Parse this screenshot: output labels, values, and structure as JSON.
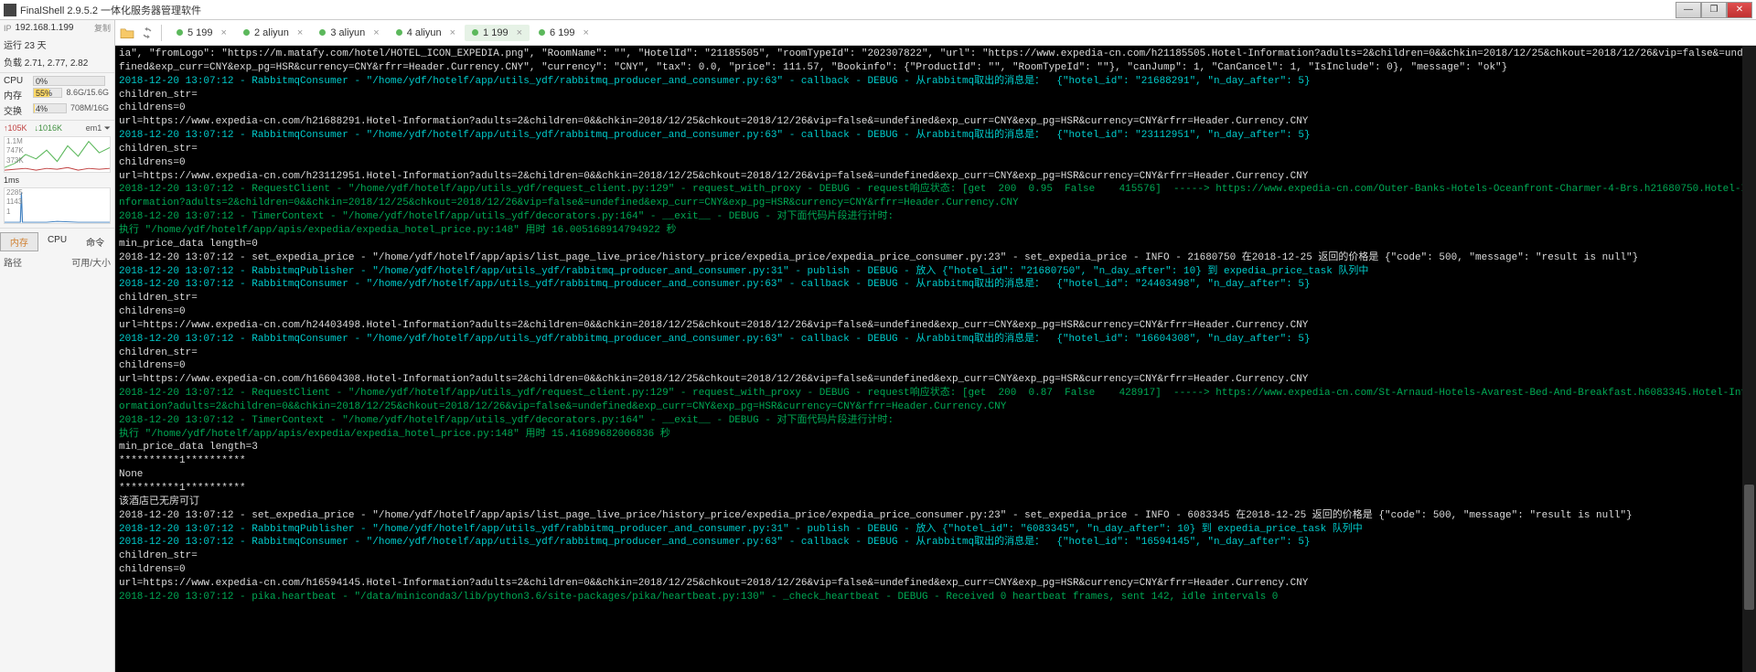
{
  "window": {
    "title": "FinalShell 2.9.5.2 一体化服务器管理软件"
  },
  "sidebar": {
    "ip_label": "IP",
    "ip_value": "192.168.1.199",
    "copy_label": "复制",
    "uptime": "运行 23 天",
    "load": "负载 2.71, 2.77, 2.82",
    "stats": [
      {
        "label": "CPU",
        "pct": "0%",
        "right": "",
        "fill": 0
      },
      {
        "label": "内存",
        "pct": "55%",
        "right": "8.6G/15.6G",
        "fill": 55
      },
      {
        "label": "交换",
        "pct": "4%",
        "right": "708M/16G",
        "fill": 4
      }
    ],
    "net": {
      "up": "↑105K",
      "down": "↓1016K",
      "iface": "em1",
      "suffix": "⏷"
    },
    "graph1_labels": [
      "1.1M",
      "747K",
      "373K"
    ],
    "graph2_labels": [
      "1ms",
      "2285",
      "1143",
      "1"
    ],
    "mtabs": [
      {
        "label": "内存",
        "active": true
      },
      {
        "label": "CPU",
        "active": false
      },
      {
        "label": "命令",
        "active": false
      }
    ],
    "cols": {
      "left": "路径",
      "right": "可用/大小"
    }
  },
  "tabs": [
    {
      "label": "5 199",
      "dot": "green",
      "active": false
    },
    {
      "label": "2 aliyun",
      "dot": "green",
      "active": false
    },
    {
      "label": "3 aliyun",
      "dot": "green",
      "active": false
    },
    {
      "label": "4 aliyun",
      "dot": "green",
      "active": false
    },
    {
      "label": "1 199",
      "dot": "green",
      "active": true
    },
    {
      "label": "6 199",
      "dot": "green",
      "active": false
    }
  ],
  "terminal_lines": [
    {
      "c": "white",
      "t": "ia\", \"fromLogo\": \"https://m.matafy.com/hotel/HOTEL_ICON_EXPEDIA.png\", \"RoomName\": \"\", \"HotelId\": \"21185505\", \"roomTypeId\": \"202307822\", \"url\": \"https://www.expedia-cn.com/h21185505.Hotel-Information?adults=2&children=0&&chkin=2018/12/25&chkout=2018/12/26&vip=false&=undefined&exp_curr=CNY&exp_pg=HSR&currency=CNY&rfrr=Header.Currency.CNY\", \"currency\": \"CNY\", \"tax\": 0.0, \"price\": 111.57, \"Bookinfo\": {\"ProductId\": \"\", \"RoomTypeId\": \"\"}, \"canJump\": 1, \"CanCancel\": 1, \"IsInclude\": 0}, \"message\": \"ok\"}"
    },
    {
      "c": "cyan",
      "t": "2018-12-20 13:07:12 - RabbitmqConsumer - \"/home/ydf/hotelf/app/utils_ydf/rabbitmq_producer_and_consumer.py:63\" - callback - DEBUG - 从rabbitmq取出的消息是：  {\"hotel_id\": \"21688291\", \"n_day_after\": 5}"
    },
    {
      "c": "white",
      "t": "children_str="
    },
    {
      "c": "white",
      "t": "childrens=0"
    },
    {
      "c": "white",
      "t": "url=https://www.expedia-cn.com/h21688291.Hotel-Information?adults=2&children=0&&chkin=2018/12/25&chkout=2018/12/26&vip=false&=undefined&exp_curr=CNY&exp_pg=HSR&currency=CNY&rfrr=Header.Currency.CNY"
    },
    {
      "c": "cyan",
      "t": "2018-12-20 13:07:12 - RabbitmqConsumer - \"/home/ydf/hotelf/app/utils_ydf/rabbitmq_producer_and_consumer.py:63\" - callback - DEBUG - 从rabbitmq取出的消息是：  {\"hotel_id\": \"23112951\", \"n_day_after\": 5}"
    },
    {
      "c": "white",
      "t": "children_str="
    },
    {
      "c": "white",
      "t": "childrens=0"
    },
    {
      "c": "white",
      "t": "url=https://www.expedia-cn.com/h23112951.Hotel-Information?adults=2&children=0&&chkin=2018/12/25&chkout=2018/12/26&vip=false&=undefined&exp_curr=CNY&exp_pg=HSR&currency=CNY&rfrr=Header.Currency.CNY"
    },
    {
      "c": "green",
      "t": "2018-12-20 13:07:12 - RequestClient - \"/home/ydf/hotelf/app/utils_ydf/request_client.py:129\" - request_with_proxy - DEBUG - request响应状态: [get  200  0.95  False    415576]  -----> https://www.expedia-cn.com/Outer-Banks-Hotels-Oceanfront-Charmer-4-Brs.h21680750.Hotel-Information?adults=2&children=0&&chkin=2018/12/25&chkout=2018/12/26&vip=false&=undefined&exp_curr=CNY&exp_pg=HSR&currency=CNY&rfrr=Header.Currency.CNY"
    },
    {
      "c": "green",
      "t": "2018-12-20 13:07:12 - TimerContext - \"/home/ydf/hotelf/app/utils_ydf/decorators.py:164\" - __exit__ - DEBUG - 对下面代码片段进行计时:"
    },
    {
      "c": "green",
      "t": "执行 \"/home/ydf/hotelf/app/apis/expedia/expedia_hotel_price.py:148\" 用时 16.005168914794922 秒"
    },
    {
      "c": "white",
      "t": "min_price_data length=0"
    },
    {
      "c": "white",
      "t": "2018-12-20 13:07:12 - set_expedia_price - \"/home/ydf/hotelf/app/apis/list_page_live_price/history_price/expedia_price/expedia_price_consumer.py:23\" - set_expedia_price - INFO - 21680750 在2018-12-25 返回的价格是 {\"code\": 500, \"message\": \"result is null\"}"
    },
    {
      "c": "cyan",
      "t": "2018-12-20 13:07:12 - RabbitmqPublisher - \"/home/ydf/hotelf/app/utils_ydf/rabbitmq_producer_and_consumer.py:31\" - publish - DEBUG - 放入 {\"hotel_id\": \"21680750\", \"n_day_after\": 10} 到 expedia_price_task 队列中"
    },
    {
      "c": "cyan",
      "t": "2018-12-20 13:07:12 - RabbitmqConsumer - \"/home/ydf/hotelf/app/utils_ydf/rabbitmq_producer_and_consumer.py:63\" - callback - DEBUG - 从rabbitmq取出的消息是：  {\"hotel_id\": \"24403498\", \"n_day_after\": 5}"
    },
    {
      "c": "white",
      "t": "children_str="
    },
    {
      "c": "white",
      "t": "childrens=0"
    },
    {
      "c": "white",
      "t": "url=https://www.expedia-cn.com/h24403498.Hotel-Information?adults=2&children=0&&chkin=2018/12/25&chkout=2018/12/26&vip=false&=undefined&exp_curr=CNY&exp_pg=HSR&currency=CNY&rfrr=Header.Currency.CNY"
    },
    {
      "c": "cyan",
      "t": "2018-12-20 13:07:12 - RabbitmqConsumer - \"/home/ydf/hotelf/app/utils_ydf/rabbitmq_producer_and_consumer.py:63\" - callback - DEBUG - 从rabbitmq取出的消息是：  {\"hotel_id\": \"16604308\", \"n_day_after\": 5}"
    },
    {
      "c": "white",
      "t": "children_str="
    },
    {
      "c": "white",
      "t": "childrens=0"
    },
    {
      "c": "white",
      "t": "url=https://www.expedia-cn.com/h16604308.Hotel-Information?adults=2&children=0&&chkin=2018/12/25&chkout=2018/12/26&vip=false&=undefined&exp_curr=CNY&exp_pg=HSR&currency=CNY&rfrr=Header.Currency.CNY"
    },
    {
      "c": "green",
      "t": "2018-12-20 13:07:12 - RequestClient - \"/home/ydf/hotelf/app/utils_ydf/request_client.py:129\" - request_with_proxy - DEBUG - request响应状态: [get  200  0.87  False    428917]  -----> https://www.expedia-cn.com/St-Arnaud-Hotels-Avarest-Bed-And-Breakfast.h6083345.Hotel-Information?adults=2&children=0&&chkin=2018/12/25&chkout=2018/12/26&vip=false&=undefined&exp_curr=CNY&exp_pg=HSR&currency=CNY&rfrr=Header.Currency.CNY"
    },
    {
      "c": "green",
      "t": "2018-12-20 13:07:12 - TimerContext - \"/home/ydf/hotelf/app/utils_ydf/decorators.py:164\" - __exit__ - DEBUG - 对下面代码片段进行计时:"
    },
    {
      "c": "green",
      "t": "执行 \"/home/ydf/hotelf/app/apis/expedia/expedia_hotel_price.py:148\" 用时 15.41689682006836 秒"
    },
    {
      "c": "white",
      "t": "min_price_data length=3"
    },
    {
      "c": "white",
      "t": "**********1**********"
    },
    {
      "c": "white",
      "t": "None"
    },
    {
      "c": "white",
      "t": "**********1**********"
    },
    {
      "c": "white",
      "t": "该酒店已无房可订"
    },
    {
      "c": "white",
      "t": "2018-12-20 13:07:12 - set_expedia_price - \"/home/ydf/hotelf/app/apis/list_page_live_price/history_price/expedia_price/expedia_price_consumer.py:23\" - set_expedia_price - INFO - 6083345 在2018-12-25 返回的价格是 {\"code\": 500, \"message\": \"result is null\"}"
    },
    {
      "c": "cyan",
      "t": "2018-12-20 13:07:12 - RabbitmqPublisher - \"/home/ydf/hotelf/app/utils_ydf/rabbitmq_producer_and_consumer.py:31\" - publish - DEBUG - 放入 {\"hotel_id\": \"6083345\", \"n_day_after\": 10} 到 expedia_price_task 队列中"
    },
    {
      "c": "cyan",
      "t": "2018-12-20 13:07:12 - RabbitmqConsumer - \"/home/ydf/hotelf/app/utils_ydf/rabbitmq_producer_and_consumer.py:63\" - callback - DEBUG - 从rabbitmq取出的消息是：  {\"hotel_id\": \"16594145\", \"n_day_after\": 5}"
    },
    {
      "c": "white",
      "t": "children_str="
    },
    {
      "c": "white",
      "t": "childrens=0"
    },
    {
      "c": "white",
      "t": "url=https://www.expedia-cn.com/h16594145.Hotel-Information?adults=2&children=0&&chkin=2018/12/25&chkout=2018/12/26&vip=false&=undefined&exp_curr=CNY&exp_pg=HSR&currency=CNY&rfrr=Header.Currency.CNY"
    },
    {
      "c": "green",
      "t": "2018-12-20 13:07:12 - pika.heartbeat - \"/data/miniconda3/lib/python3.6/site-packages/pika/heartbeat.py:130\" - _check_heartbeat - DEBUG - Received 0 heartbeat frames, sent 142, idle intervals 0"
    }
  ]
}
